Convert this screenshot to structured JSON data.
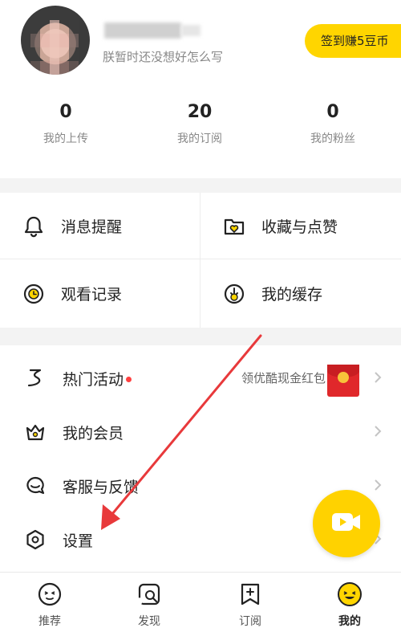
{
  "profile": {
    "signature": "朕暂时还没想好怎么写",
    "checkin_label": "签到赚5豆币"
  },
  "stats": [
    {
      "value": "0",
      "label": "我的上传"
    },
    {
      "value": "20",
      "label": "我的订阅"
    },
    {
      "value": "0",
      "label": "我的粉丝"
    }
  ],
  "grid": [
    {
      "label": "消息提醒",
      "icon": "bell-icon"
    },
    {
      "label": "收藏与点赞",
      "icon": "folder-heart-icon"
    },
    {
      "label": "观看记录",
      "icon": "history-clock-icon"
    },
    {
      "label": "我的缓存",
      "icon": "download-icon"
    }
  ],
  "list": [
    {
      "label": "热门活动",
      "icon": "activity-icon",
      "promo": "领优酷现金红包"
    },
    {
      "label": "我的会员",
      "icon": "crown-icon"
    },
    {
      "label": "客服与反馈",
      "icon": "chat-icon"
    },
    {
      "label": "设置",
      "icon": "settings-icon"
    }
  ],
  "tabs": [
    {
      "label": "推荐",
      "icon": "recommend-face-icon"
    },
    {
      "label": "发现",
      "icon": "discover-icon"
    },
    {
      "label": "订阅",
      "icon": "subscribe-icon"
    },
    {
      "label": "我的",
      "icon": "mine-face-icon",
      "active": true
    }
  ],
  "colors": {
    "accent": "#ffd500",
    "annotation_arrow": "#e8393b",
    "badge": "#ff4040"
  }
}
